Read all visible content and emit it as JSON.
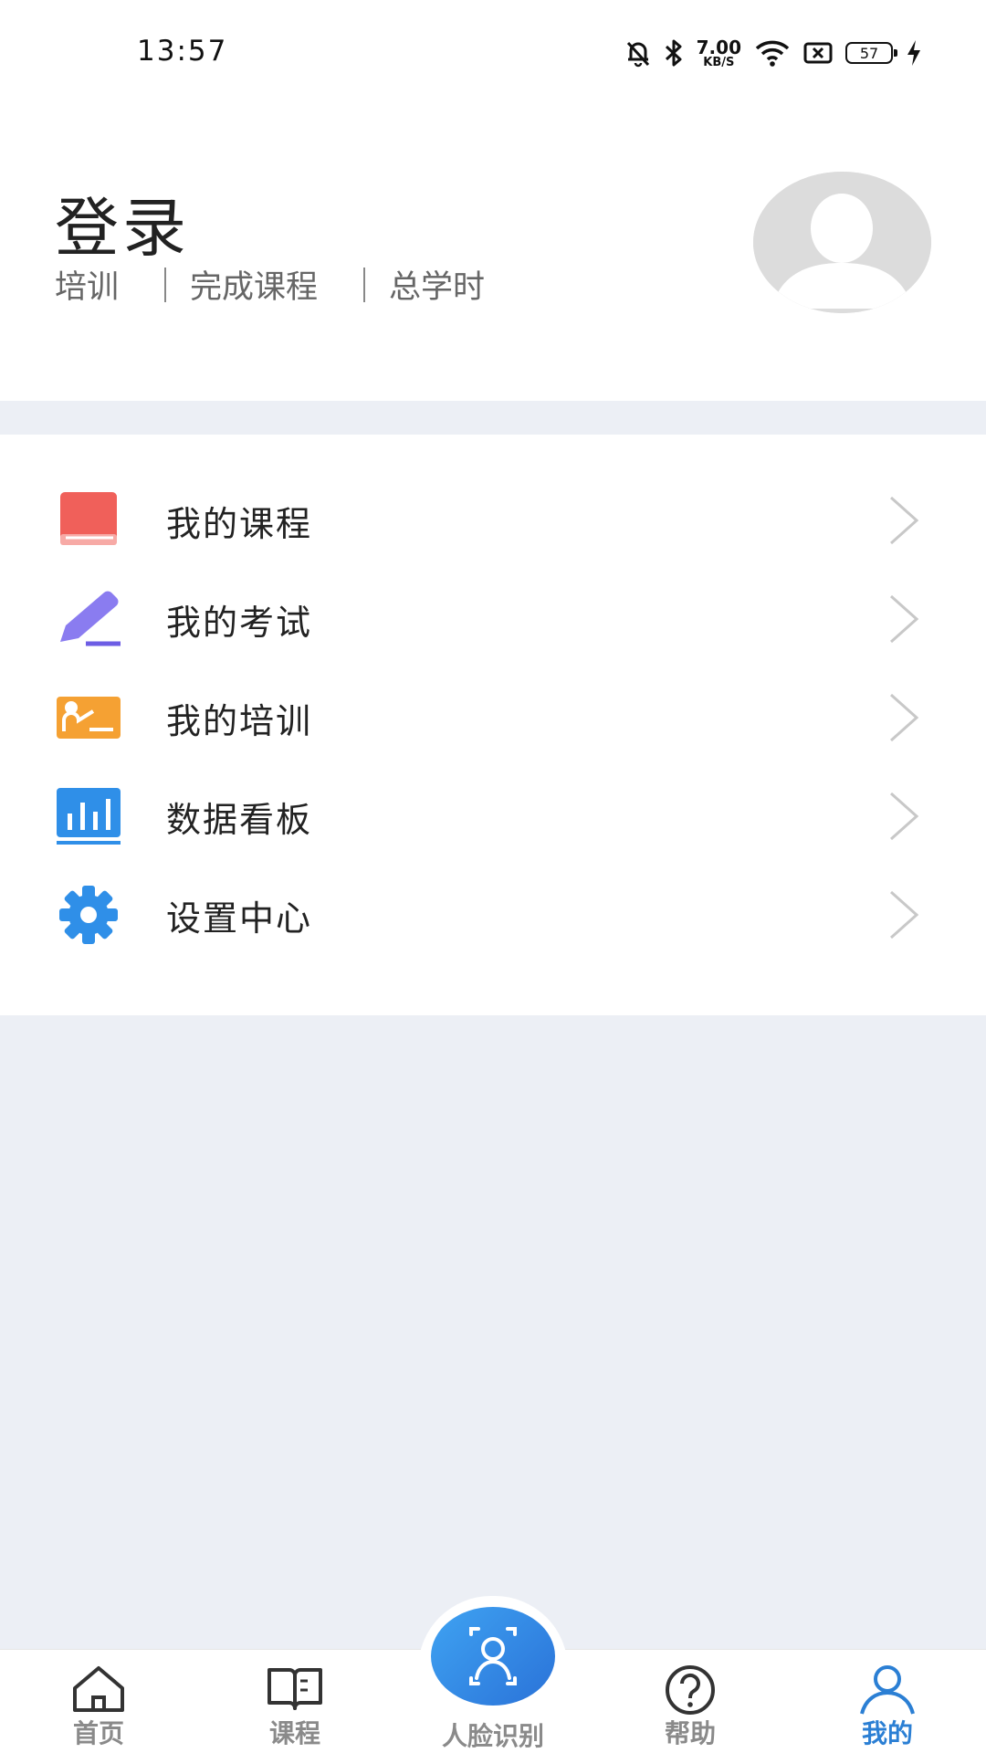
{
  "status_bar": {
    "time": "13:57",
    "net_speed_value": "7.00",
    "net_speed_unit": "KB/S",
    "battery": "57",
    "icons": [
      "mute-bell-icon",
      "bluetooth-icon",
      "wifi-icon",
      "no-sim-icon",
      "battery-icon",
      "charging-icon"
    ]
  },
  "profile": {
    "title": "登录",
    "stats": [
      "培训",
      "完成课程",
      "总学时"
    ],
    "avatar_icon": "default-avatar-icon"
  },
  "menu": {
    "items": [
      {
        "label": "我的课程",
        "icon": "book-icon",
        "color": "#f0605a"
      },
      {
        "label": "我的考试",
        "icon": "pencil-icon",
        "color": "#8a7cf0"
      },
      {
        "label": "我的培训",
        "icon": "training-board-icon",
        "color": "#f5a133"
      },
      {
        "label": "数据看板",
        "icon": "bar-chart-icon",
        "color": "#2f8fe8"
      },
      {
        "label": "设置中心",
        "icon": "gear-icon",
        "color": "#2f8fe8"
      }
    ]
  },
  "bottom_nav": {
    "items": [
      {
        "label": "首页",
        "icon": "home-icon"
      },
      {
        "label": "课程",
        "icon": "open-book-icon"
      },
      {
        "label": "人脸识别",
        "icon": "face-scan-icon"
      },
      {
        "label": "帮助",
        "icon": "help-icon"
      },
      {
        "label": "我的",
        "icon": "person-icon",
        "active": true
      }
    ],
    "active_color": "#2b7fd4",
    "inactive_color": "#8a8a8a"
  }
}
